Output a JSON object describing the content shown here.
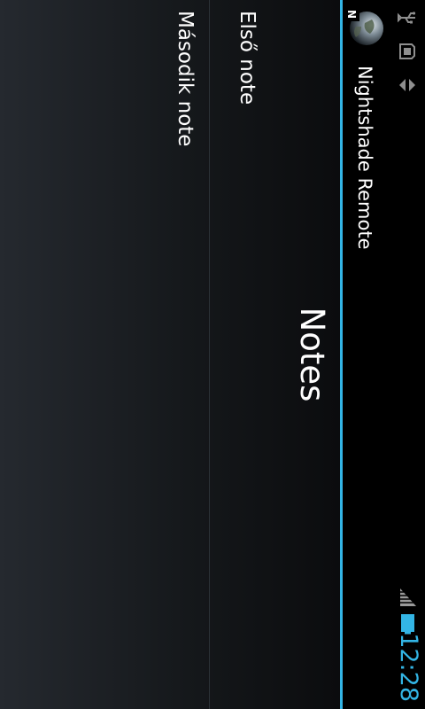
{
  "status_bar": {
    "time": "12:28",
    "icons": [
      "usb-icon",
      "sd-card-icon",
      "sync-icon",
      "signal-icon",
      "battery-icon"
    ],
    "accent_color": "#33b5e5"
  },
  "action_bar": {
    "title": "Nightshade Remote",
    "icon_letter": "N",
    "accent_color": "#33b5e5"
  },
  "page": {
    "title": "Notes"
  },
  "notes": [
    {
      "label": "Első note"
    },
    {
      "label": "Második note"
    }
  ]
}
